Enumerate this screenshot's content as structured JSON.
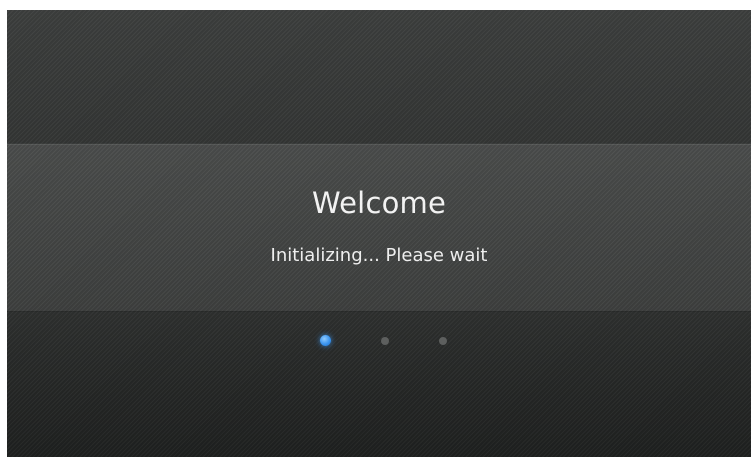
{
  "screen": {
    "title": "Welcome",
    "status": "Initializing... Please wait"
  },
  "progress": {
    "total_dots": 3,
    "active_index": 0,
    "active_color": "#3a94ef",
    "inactive_color": "#5d5f5e"
  },
  "colors": {
    "background_dark": "#262827",
    "background_mid": "#464847",
    "text": "#f2f2f2"
  }
}
